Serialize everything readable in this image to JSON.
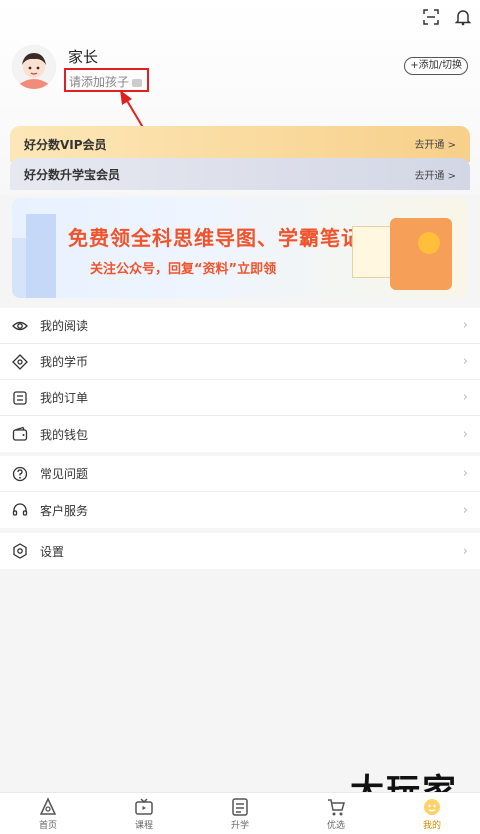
{
  "header": {
    "username": "家长",
    "add_child": "请添加孩子",
    "switch_button": "+添加/切换"
  },
  "vip": [
    {
      "title": "好分数VIP会员",
      "action": "去开通 >"
    },
    {
      "title": "好分数升学宝会员",
      "action": "去开通 >"
    }
  ],
  "banner": {
    "line1": "免费领全科思维导图、学霸笔记",
    "line2": "关注公众号，回复“资料”立即领"
  },
  "menu": {
    "group1": [
      {
        "label": "我的阅读",
        "icon": "eye-icon"
      },
      {
        "label": "我的学币",
        "icon": "coin-icon"
      },
      {
        "label": "我的订单",
        "icon": "order-icon"
      },
      {
        "label": "我的钱包",
        "icon": "wallet-icon"
      }
    ],
    "group2": [
      {
        "label": "常见问题",
        "icon": "question-icon"
      },
      {
        "label": "客户服务",
        "icon": "headset-icon"
      }
    ],
    "group3": [
      {
        "label": "设置",
        "icon": "gear-icon"
      }
    ]
  },
  "tabs": [
    {
      "label": "首页",
      "icon": "home-icon"
    },
    {
      "label": "课程",
      "icon": "tv-icon"
    },
    {
      "label": "升学",
      "icon": "document-icon"
    },
    {
      "label": "优选",
      "icon": "cart-icon"
    },
    {
      "label": "我的",
      "icon": "profile-icon"
    }
  ],
  "active_tab": "我的",
  "watermark": "大玩家",
  "colors": {
    "accent": "#d88a00",
    "highlight_box": "#e02020",
    "banner_text": "#f0542d"
  }
}
